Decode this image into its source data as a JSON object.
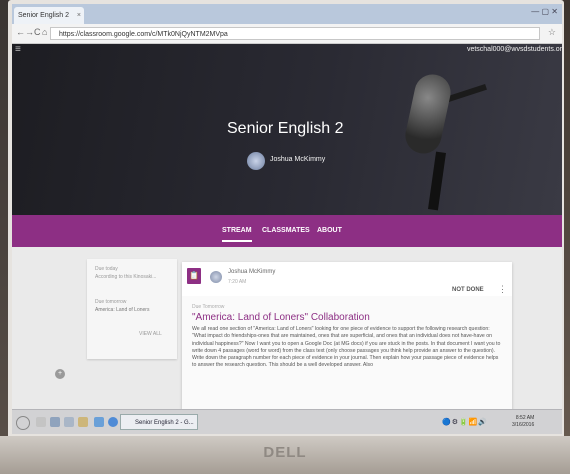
{
  "browser": {
    "tab_title": "Senior English 2",
    "tab_close": "×",
    "window_controls": "— ▢ ✕",
    "url": "https://classroom.google.com/c/MTk0NjQyNTM2MVpa",
    "nav_back": "←",
    "nav_forward": "→",
    "nav_reload": "C",
    "nav_home": "⌂",
    "star_icon": "☆"
  },
  "classroom": {
    "menu_icon": "≡",
    "user_email": "vetschal000@wvsdstudents.or",
    "class_title": "Senior English 2",
    "teacher_name": "Joshua McKimmy",
    "tabs": [
      {
        "label": "STREAM",
        "active": true
      },
      {
        "label": "CLASSMATES",
        "active": false
      },
      {
        "label": "ABOUT",
        "active": false
      }
    ],
    "sidebar": {
      "due_label": "Due today",
      "due_item": "According to this Kinosaki...",
      "upcoming_label": "Due tomorrow",
      "upcoming_item": "America: Land of Loners",
      "view_all": "VIEW ALL",
      "add_button": "+"
    },
    "post": {
      "icon": "📋",
      "author": "Joshua McKimmy",
      "time": "7:20 AM",
      "status": "NOT DONE",
      "kebab": "⋮",
      "due": "Due Tomorrow",
      "title": "\"America: Land of Loners\" Collaboration",
      "body": "We all read one section of \"America: Land of Loners\" looking for one piece of evidence to support the following research question: \"What impact do friendships-ones that are maintained, ones that are superficial, and ones that an individual does not have-have on individual happiness?\" Now I want you to open a Google Doc (at MG docs) if you are stuck in the posts. In that document I want you to write down 4 passages (word for word) from the class text (only choose passages you think help provide an answer to the question). Write down the paragraph number for each piece of evidence in your journal. Then explain how your passage piece of evidence helps to answer the research question. This should be a well developed answer. Also"
    }
  },
  "taskbar": {
    "active_window": "Senior English 2 - G...",
    "tray_icons": "🔵⚙🔋📶🔊",
    "time": "8:52 AM",
    "date": "3/16/2016"
  },
  "device": {
    "brand": "DELL"
  }
}
